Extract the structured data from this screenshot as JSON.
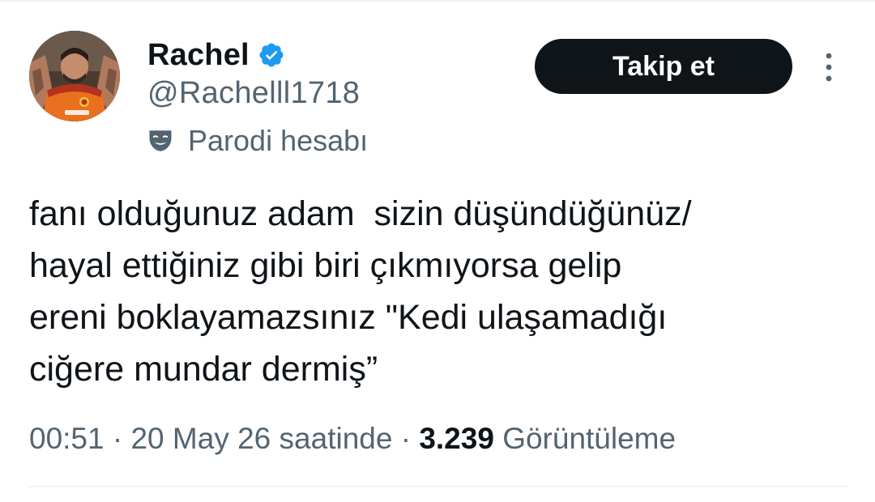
{
  "author": {
    "display_name": "Rachel",
    "handle": "@Rachelll1718",
    "verified": true,
    "verified_icon": "verified-badge-icon",
    "label": "Parodi hesabı",
    "label_icon": "parody-mask-icon",
    "avatar": "profile-photo"
  },
  "actions": {
    "follow_label": "Takip et",
    "more_icon": "more-vertical-icon"
  },
  "tweet": {
    "lines": [
      "fanı olduğunuz adam  sizin düşündüğünüz/",
      "hayal ettiğiniz gibi biri çıkmıyorsa gelip",
      "ereni boklayamazsınız \"Kedi ulaşamadığı",
      "ciğere mundar dermiş”"
    ]
  },
  "meta": {
    "time": "00:51",
    "separator": " · ",
    "date": "20 May 26 saatinde",
    "views_count": "3.239",
    "views_label": "Görüntüleme"
  },
  "colors": {
    "text_primary": "#0f1419",
    "text_secondary": "#536471",
    "verified_blue": "#1d9bf0",
    "button_bg": "#0f1419",
    "divider": "#eff3f4"
  }
}
